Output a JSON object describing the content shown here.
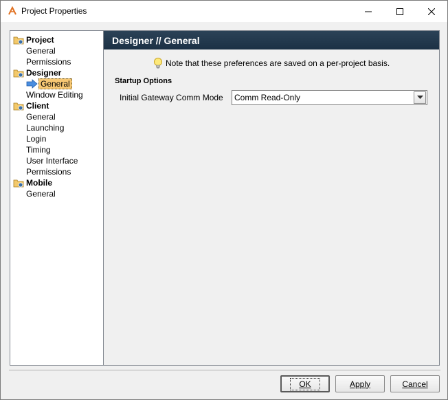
{
  "window": {
    "title": "Project Properties"
  },
  "tree": {
    "groups": [
      {
        "label": "Project",
        "items": [
          "General",
          "Permissions"
        ]
      },
      {
        "label": "Designer",
        "items": [
          "General",
          "Window Editing"
        ]
      },
      {
        "label": "Client",
        "items": [
          "General",
          "Launching",
          "Login",
          "Timing",
          "User Interface",
          "Permissions"
        ]
      },
      {
        "label": "Mobile",
        "items": [
          "General"
        ]
      }
    ],
    "selected": "Designer // General"
  },
  "content": {
    "header": "Designer // General",
    "note": "Note that these preferences are saved on a per-project basis.",
    "section_title": "Startup Options",
    "field_label": "Initial Gateway Comm Mode",
    "field_value": "Comm Read-Only"
  },
  "buttons": {
    "ok": "OK",
    "apply": "Apply",
    "cancel": "Cancel"
  },
  "colors": {
    "header_bg": "#1c3145",
    "selection_bg": "#f6c773"
  }
}
